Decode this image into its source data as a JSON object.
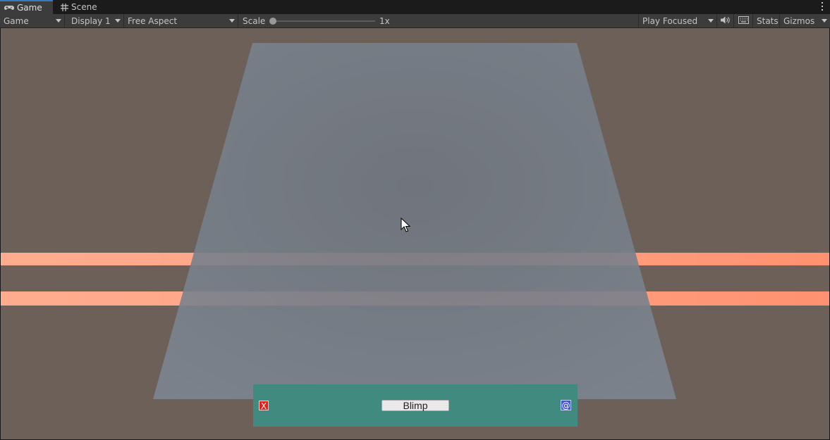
{
  "tabs": [
    {
      "label": "Game",
      "icon": "gamepad-icon",
      "active": true
    },
    {
      "label": "Scene",
      "icon": "grid-icon",
      "active": false
    }
  ],
  "toolbar": {
    "view_mode": "Game",
    "display": "Display 1",
    "aspect": "Free Aspect",
    "scale_label": "Scale",
    "scale_value": "1x",
    "scale_level": 0.0,
    "play_mode": "Play Focused",
    "stats": "Stats",
    "gizmos": "Gizmos"
  },
  "hud": {
    "close_label": "X",
    "center_button": "Blimp",
    "at_label": "@"
  },
  "colors": {
    "viewport_bg": "#6c6059",
    "plane": "#78808b",
    "stripe": "#ffa585",
    "hud_panel": "#408a80",
    "close_button": "#e8201c",
    "at_button": "#4254e6"
  }
}
